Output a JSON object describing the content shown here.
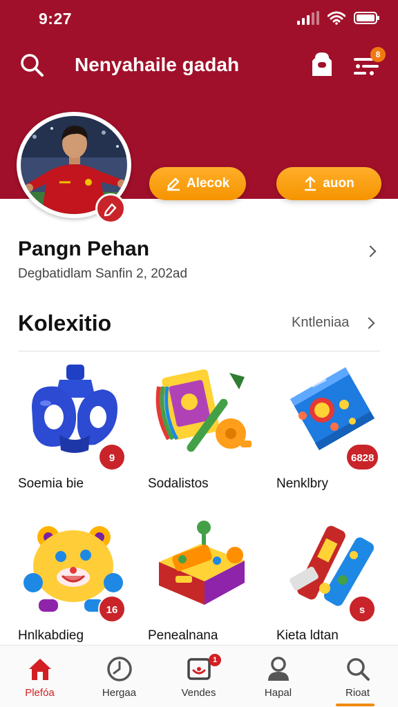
{
  "status_bar": {
    "time": "9:27"
  },
  "header": {
    "title": "Nenyahaile gadah",
    "menu_badge": "8",
    "icons": [
      "search-icon",
      "bag-icon",
      "menu-icon"
    ],
    "colors": {
      "header_bg": "#a0102a",
      "accent": "#f59400",
      "badge": "#c8242a"
    }
  },
  "profile": {
    "actions": [
      {
        "label": "Alecok",
        "icon": "edit-icon"
      },
      {
        "label": "auon",
        "icon": "upload-icon"
      }
    ],
    "name": "Pangn Pehan",
    "subtitle": "Degbatidlam Sanfin 2, 202ad"
  },
  "collection": {
    "title": "Kolexitio",
    "link": "Kntleniaa",
    "items": [
      {
        "label": "Soemia bie",
        "count": "9",
        "icon": "blue-toy-icon"
      },
      {
        "label": "Sodalistos",
        "count": "",
        "icon": "toy-set-icon"
      },
      {
        "label": "Nenklbry",
        "count": "6828",
        "icon": "snack-bag-icon"
      },
      {
        "label": "Hnlkabdieg",
        "count": "16",
        "icon": "bear-toy-icon"
      },
      {
        "label": "Penealnana",
        "count": "",
        "icon": "toy-car-icon"
      },
      {
        "label": "Kieta ldtan",
        "count": "s",
        "icon": "candy-tubes-icon"
      }
    ]
  },
  "bottom_nav": {
    "items": [
      {
        "label": "Plefóa",
        "icon": "home-icon",
        "active": true
      },
      {
        "label": "Hergaa",
        "icon": "clock-icon",
        "active": false
      },
      {
        "label": "Vendes",
        "icon": "inbox-icon",
        "active": false,
        "badge": "1"
      },
      {
        "label": "Hapal",
        "icon": "person-icon",
        "active": false
      },
      {
        "label": "Rioat",
        "icon": "search-icon",
        "active": false
      }
    ]
  }
}
